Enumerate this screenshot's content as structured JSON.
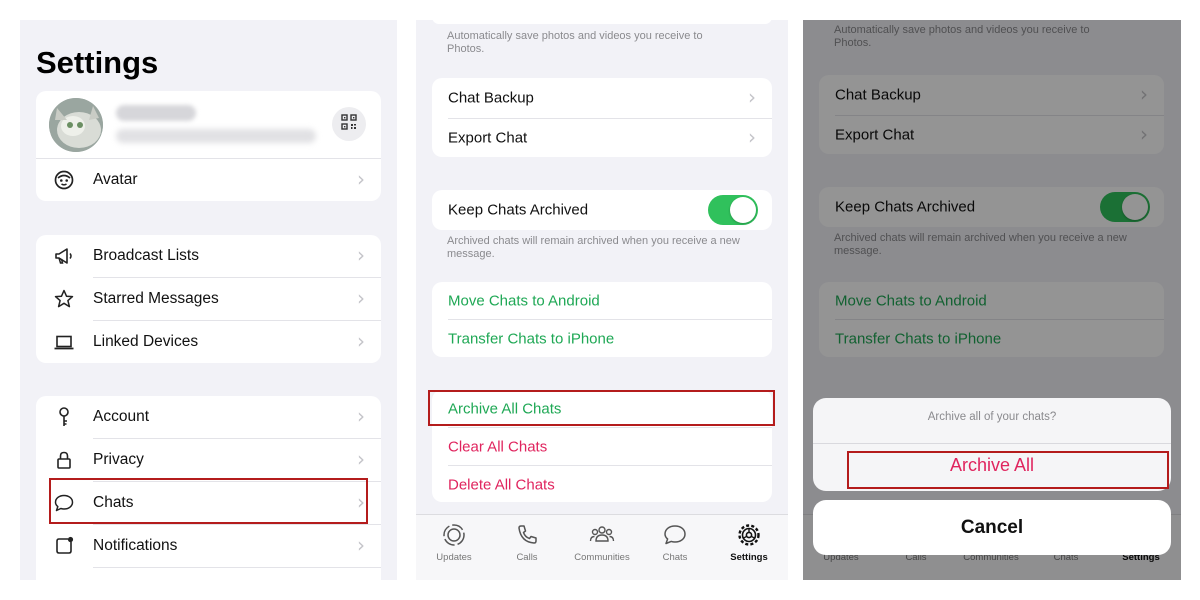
{
  "settings_screen": {
    "title": "Settings",
    "avatar_row": {
      "label": "Avatar"
    },
    "group2": [
      {
        "label": "Broadcast Lists",
        "icon": "megaphone-icon"
      },
      {
        "label": "Starred Messages",
        "icon": "star-icon"
      },
      {
        "label": "Linked Devices",
        "icon": "laptop-icon"
      }
    ],
    "group3": [
      {
        "label": "Account",
        "icon": "key-icon"
      },
      {
        "label": "Privacy",
        "icon": "lock-icon"
      },
      {
        "label": "Chats",
        "icon": "chat-bubble-icon"
      },
      {
        "label": "Notifications",
        "icon": "notification-icon"
      }
    ]
  },
  "chats_screen": {
    "save_note": "Automatically save photos and videos you receive to Photos.",
    "backup_label": "Chat Backup",
    "export_label": "Export Chat",
    "keep_archived_label": "Keep Chats Archived",
    "keep_archived_on": true,
    "archived_note": "Archived chats will remain archived when you receive a new message.",
    "move_android_label": "Move Chats to Android",
    "transfer_iphone_label": "Transfer Chats to iPhone",
    "archive_all_label": "Archive All Chats",
    "clear_all_label": "Clear All Chats",
    "delete_all_label": "Delete All Chats"
  },
  "tab_bar": {
    "updates": "Updates",
    "calls": "Calls",
    "communities": "Communities",
    "chats": "Chats",
    "settings": "Settings"
  },
  "archive_dialog": {
    "title": "Archive all of your chats?",
    "confirm_label": "Archive All",
    "cancel_label": "Cancel"
  },
  "colors": {
    "accent_green": "#1fa855",
    "destructive_red": "#e0245e",
    "highlight_box": "#b41c1c",
    "toggle_on": "#30c15c"
  }
}
